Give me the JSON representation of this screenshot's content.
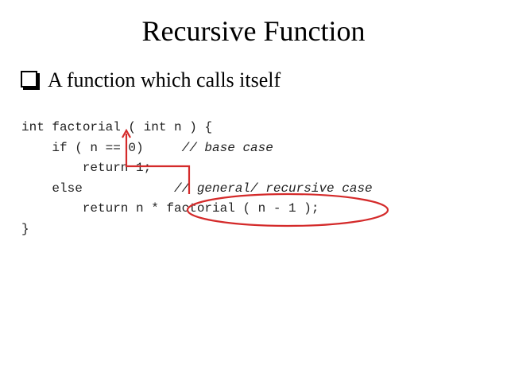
{
  "slide": {
    "title": "Recursive Function",
    "bullet": "A function which calls itself"
  },
  "code": {
    "line1": "int factorial ( int n ) {",
    "line2_code": "if ( n == 0)     ",
    "line2_comment": "// base case",
    "line3": "return 1;",
    "line4_code": "else            ",
    "line4_comment": "// general/ recursive case",
    "line5_a": "return n * ",
    "line5_call": "factorial ( n - 1 )",
    "line5_b": ";",
    "line6": "}"
  },
  "annotation": {
    "color": "#d42a2a",
    "highlight_shape": "ellipse",
    "arrow_target": "factorial"
  }
}
